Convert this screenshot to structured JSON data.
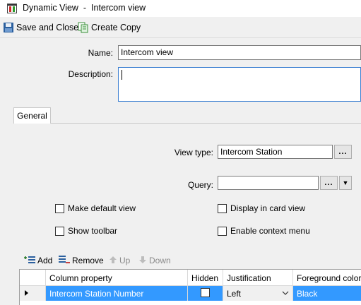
{
  "window": {
    "title": "Dynamic View  -  Intercom view"
  },
  "toolbar": {
    "save_close_label": "Save and Close",
    "create_copy_label": "Create Copy"
  },
  "form": {
    "name_label": "Name:",
    "name_value": "Intercom view",
    "description_label": "Description:",
    "description_value": ""
  },
  "tabs": [
    {
      "label": "General",
      "selected": true
    }
  ],
  "general": {
    "view_type_label": "View type:",
    "view_type_value": "Intercom Station",
    "query_label": "Query:",
    "query_value": "",
    "browse_label": "...",
    "options": {
      "make_default_view": {
        "label": "Make default view",
        "checked": false
      },
      "show_toolbar": {
        "label": "Show toolbar",
        "checked": false
      },
      "display_in_card_view": {
        "label": "Display in card view",
        "checked": false
      },
      "enable_context_menu": {
        "label": "Enable context menu",
        "checked": false
      }
    }
  },
  "grid_toolbar": {
    "add_label": "Add",
    "remove_label": "Remove",
    "up_label": "Up",
    "down_label": "Down"
  },
  "grid": {
    "columns": [
      "",
      "Column property",
      "Hidden",
      "Justification",
      "Foreground color"
    ],
    "rows": [
      {
        "column_property": "Intercom Station Number",
        "hidden": false,
        "justification": "Left",
        "foreground_color": "Black",
        "selected": true
      }
    ]
  },
  "colors": {
    "selection": "#3399ff",
    "focus_border": "#3b7fd1"
  }
}
